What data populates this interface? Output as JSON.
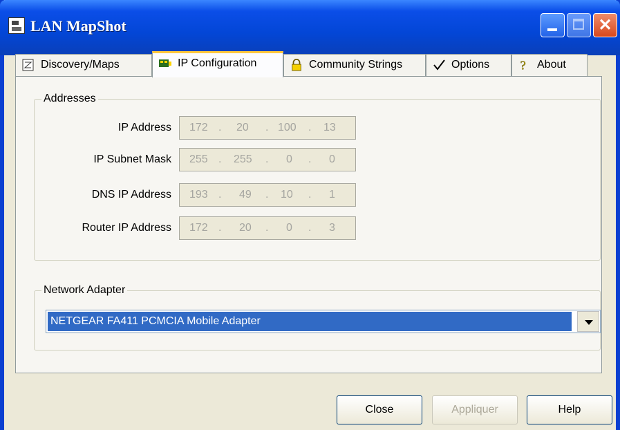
{
  "window": {
    "title": "LAN MapShot"
  },
  "tabs": [
    {
      "label": "Discovery/Maps",
      "icon": "map-icon"
    },
    {
      "label": "IP Configuration",
      "icon": "network-card-icon"
    },
    {
      "label": "Community Strings",
      "icon": "lock-icon"
    },
    {
      "label": "Options",
      "icon": "checkmark-icon"
    },
    {
      "label": "About",
      "icon": "question-icon"
    }
  ],
  "addresses": {
    "legend": "Addresses",
    "rows": [
      {
        "label": "IP Address",
        "octets": [
          "172",
          "20",
          "100",
          "13"
        ]
      },
      {
        "label": "IP Subnet Mask",
        "octets": [
          "255",
          "255",
          "0",
          "0"
        ]
      },
      {
        "label": "DNS IP Address",
        "octets": [
          "193",
          "49",
          "10",
          "1"
        ]
      },
      {
        "label": "Router IP Address",
        "octets": [
          "172",
          "20",
          "0",
          "3"
        ]
      }
    ]
  },
  "adapter": {
    "legend": "Network Adapter",
    "selected": "NETGEAR FA411 PCMCIA Mobile Adapter"
  },
  "buttons": {
    "close": "Close",
    "apply": "Appliquer",
    "help": "Help"
  }
}
